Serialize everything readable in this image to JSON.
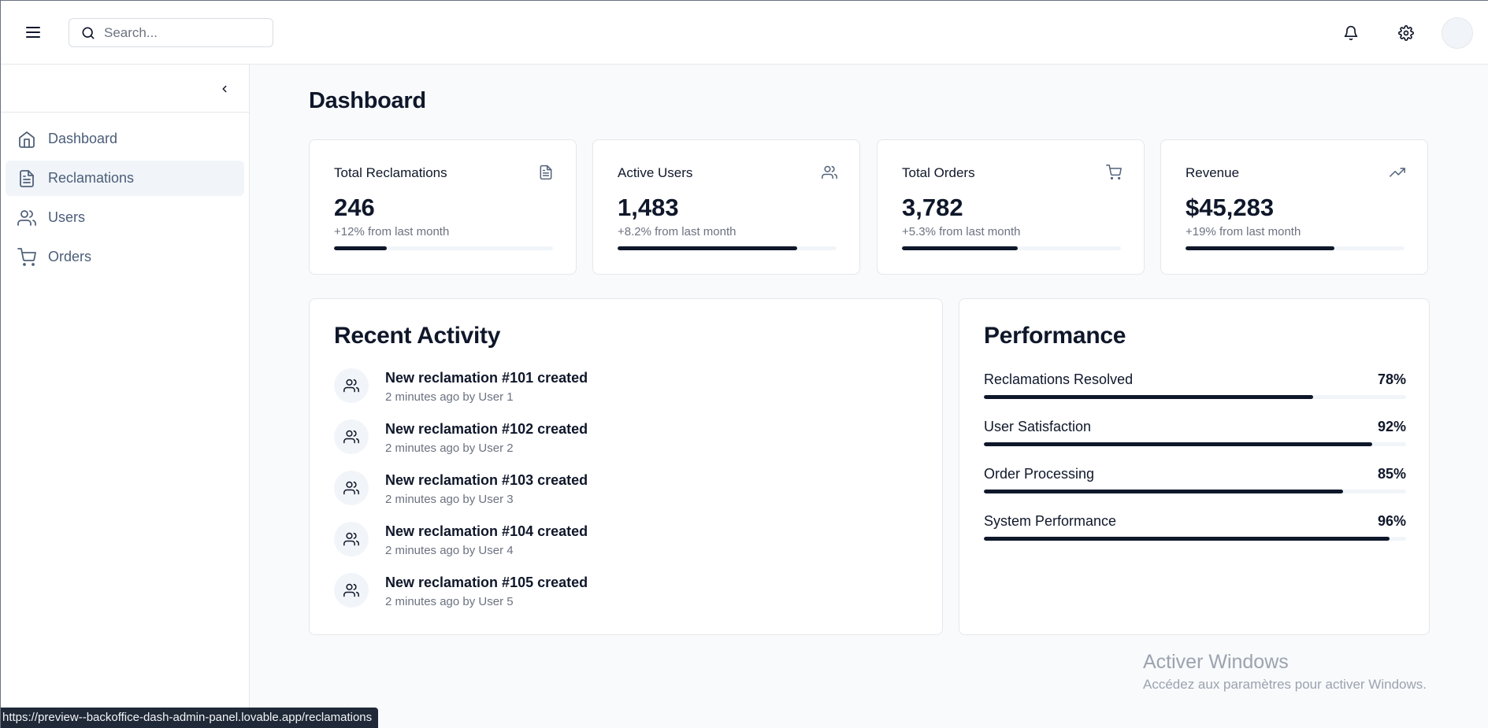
{
  "header": {
    "search_placeholder": "Search...",
    "icons": [
      "menu-icon",
      "search-icon",
      "bell-icon",
      "gear-icon"
    ]
  },
  "sidebar": {
    "items": [
      {
        "label": "Dashboard",
        "icon": "home-icon",
        "active": false
      },
      {
        "label": "Reclamations",
        "icon": "file-icon",
        "active": true
      },
      {
        "label": "Users",
        "icon": "users-icon",
        "active": false
      },
      {
        "label": "Orders",
        "icon": "cart-icon",
        "active": false
      }
    ]
  },
  "main": {
    "title": "Dashboard",
    "stats": [
      {
        "title": "Total Reclamations",
        "value": "246",
        "change": "+12% from last month",
        "icon": "file-icon",
        "progress": 0.24
      },
      {
        "title": "Active Users",
        "value": "1,483",
        "change": "+8.2% from last month",
        "icon": "users-icon",
        "progress": 0.82
      },
      {
        "title": "Total Orders",
        "value": "3,782",
        "change": "+5.3% from last month",
        "icon": "cart-icon",
        "progress": 0.53
      },
      {
        "title": "Revenue",
        "value": "$45,283",
        "change": "+19% from last month",
        "icon": "trending-up-icon",
        "progress": 0.68
      }
    ],
    "recent_activity": {
      "title": "Recent Activity",
      "items": [
        {
          "title": "New reclamation #101 created",
          "subtitle": "2 minutes ago by User 1"
        },
        {
          "title": "New reclamation #102 created",
          "subtitle": "2 minutes ago by User 2"
        },
        {
          "title": "New reclamation #103 created",
          "subtitle": "2 minutes ago by User 3"
        },
        {
          "title": "New reclamation #104 created",
          "subtitle": "2 minutes ago by User 4"
        },
        {
          "title": "New reclamation #105 created",
          "subtitle": "2 minutes ago by User 5"
        }
      ]
    },
    "performance": {
      "title": "Performance",
      "items": [
        {
          "label": "Reclamations Resolved",
          "percent": "78%",
          "value": 78
        },
        {
          "label": "User Satisfaction",
          "percent": "92%",
          "value": 92
        },
        {
          "label": "Order Processing",
          "percent": "85%",
          "value": 85
        },
        {
          "label": "System Performance",
          "percent": "96%",
          "value": 96
        }
      ]
    }
  },
  "watermark": {
    "line1": "Activer Windows",
    "line2": "Accédez aux paramètres pour activer Windows."
  },
  "status_bar": {
    "url": "https://preview--backoffice-dash-admin-panel.lovable.app/reclamations"
  },
  "colors": {
    "primary": "#0f172a",
    "muted_text": "#6b7280",
    "border": "#e5e7eb",
    "page_bg": "#f8fafc",
    "active_nav_bg": "#f1f5f9"
  }
}
